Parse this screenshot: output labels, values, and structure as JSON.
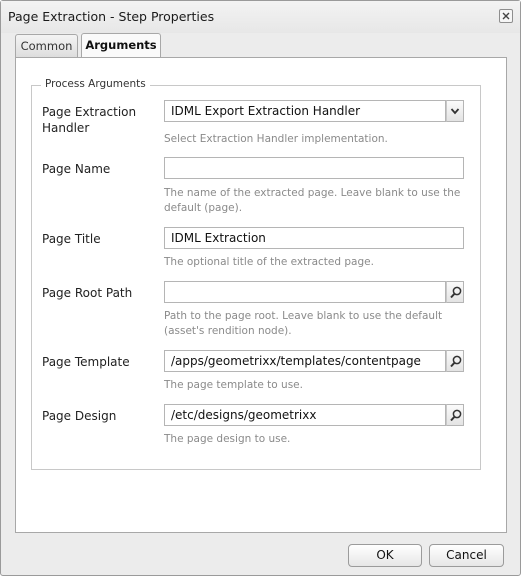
{
  "window": {
    "title": "Page Extraction - Step Properties"
  },
  "tabs": [
    {
      "label": "Common"
    },
    {
      "label": "Arguments"
    }
  ],
  "fieldset": {
    "legend": "Process Arguments"
  },
  "fields": {
    "handler": {
      "label": "Page Extraction Handler",
      "value": "IDML Export Extraction Handler",
      "help": "Select Extraction Handler implementation."
    },
    "page_name": {
      "label": "Page Name",
      "value": "",
      "help": "The name of the extracted page. Leave blank to use the default (page)."
    },
    "page_title": {
      "label": "Page Title",
      "value": "IDML Extraction",
      "help": "The optional title of the extracted page."
    },
    "page_root_path": {
      "label": "Page Root Path",
      "value": "",
      "help": "Path to the page root. Leave blank to use the default (asset's rendition node)."
    },
    "page_template": {
      "label": "Page Template",
      "value": "/apps/geometrixx/templates/contentpage",
      "help": "The page template to use."
    },
    "page_design": {
      "label": "Page Design",
      "value": "/etc/designs/geometrixx",
      "help": "The page design to use."
    }
  },
  "buttons": {
    "ok": "OK",
    "cancel": "Cancel"
  },
  "icons": {
    "close": "close-icon",
    "dropdown": "chevron-down-icon",
    "browse": "search-icon"
  }
}
